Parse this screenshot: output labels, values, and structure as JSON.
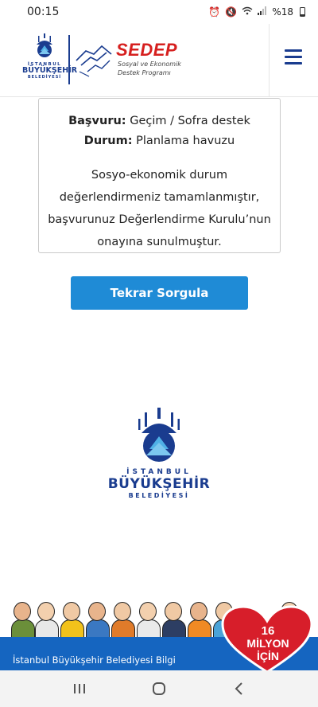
{
  "status_bar": {
    "time": "00:15",
    "icons": [
      "alarm-icon",
      "mute-icon",
      "wifi-icon",
      "signal-icon"
    ],
    "battery_text": "%18"
  },
  "header": {
    "logo_top": "İSTANBUL",
    "logo_mid": "BÜYÜKŞEHİR",
    "logo_bot": "BELEDİYESİ",
    "sedep_title": "SEDEP",
    "sedep_sub1": "Sosyal ve Ekonomik",
    "sedep_sub2": "Destek Programı"
  },
  "result": {
    "basvuru_label": "Başvuru:",
    "basvuru_value": "Geçim / Sofra destek",
    "durum_label": "Durum:",
    "durum_value": "Planlama havuzu",
    "message_line1": "Sosyo-ekonomik durum",
    "message_line2": "değerlendirmeniz tamamlanmıştır,",
    "message_line3": "başvurunuz Değerlendirme Kurulu’nun",
    "message_line4": "onayına sunulmuştur."
  },
  "requery_button_label": "Tekrar Sorgula",
  "big_logo": {
    "line1": "İSTANBUL",
    "line2": "BÜYÜKŞEHİR",
    "line3": "BELEDİYESİ"
  },
  "banner": {
    "number": "16",
    "milyon": "MİLYON",
    "icin": "İÇİN"
  },
  "footer_text": "İstanbul Büyükşehir Belediyesi Bilgi",
  "colors": {
    "brand_blue": "#1a3c8f",
    "button_blue": "#1f8bd6",
    "sedep_red": "#d6201f",
    "footer_blue": "#1565c0",
    "heart_red": "#d71e2a"
  }
}
